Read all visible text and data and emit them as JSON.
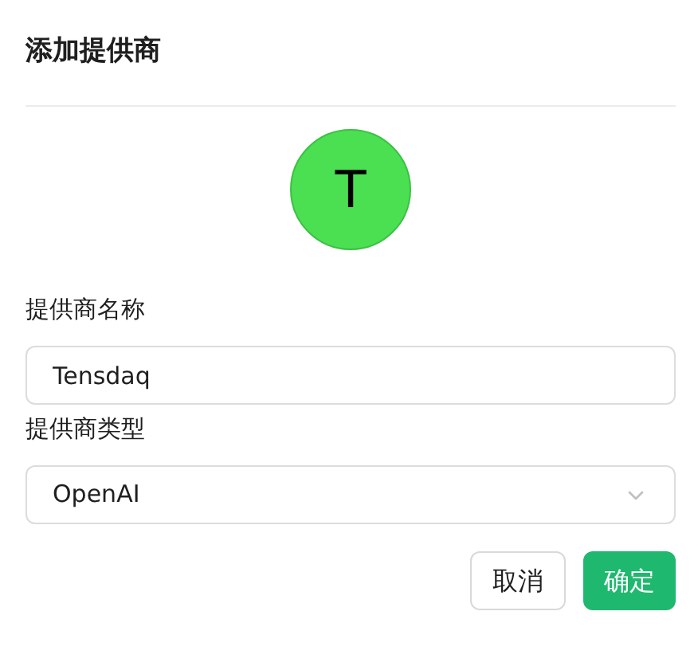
{
  "dialog": {
    "title": "添加提供商"
  },
  "avatar": {
    "letter": "T",
    "color": "#4ae052"
  },
  "fields": [
    {
      "kind": "input",
      "label": "提供商名称",
      "value": "Tensdaq"
    },
    {
      "kind": "select",
      "label": "提供商类型",
      "value": "OpenAI"
    }
  ],
  "buttons": [
    {
      "label": "取消",
      "kind": "secondary"
    },
    {
      "label": "确定",
      "kind": "primary"
    }
  ]
}
